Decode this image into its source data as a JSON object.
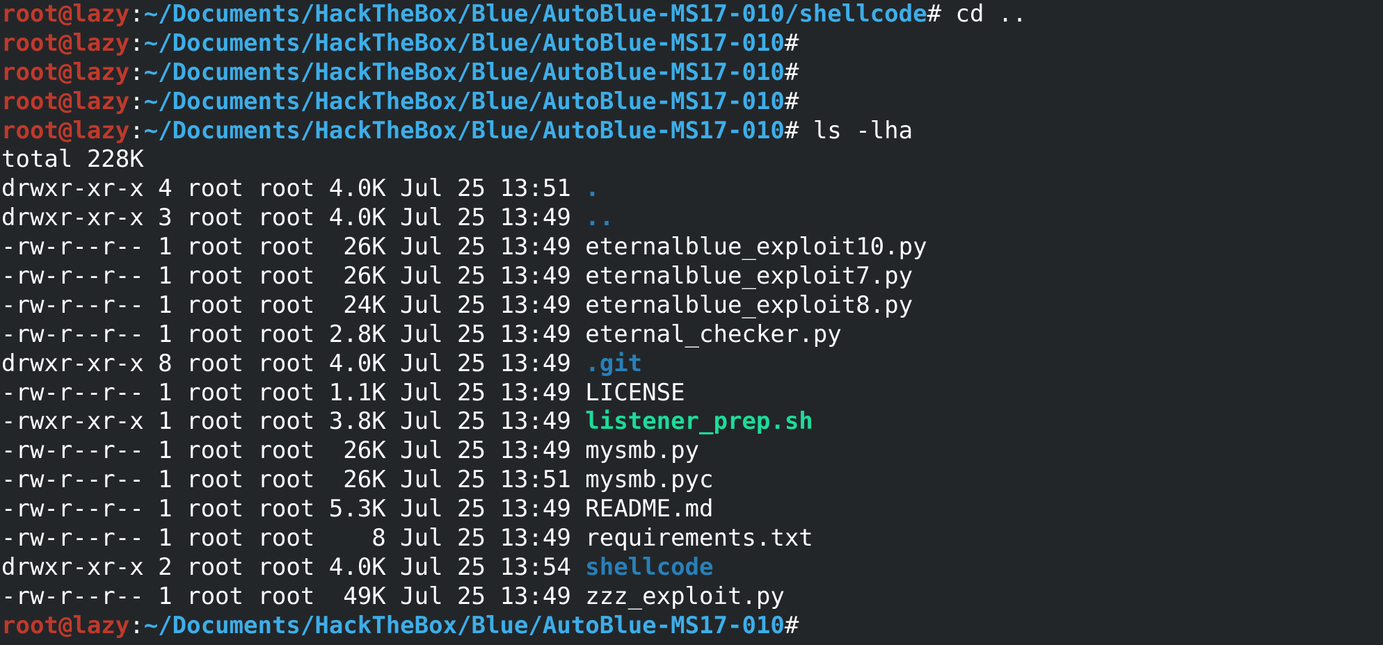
{
  "colors": {
    "background": "#232629",
    "foreground": "#fcfcfc",
    "prompt_user": "#c0392b",
    "prompt_path": "#3daee9",
    "directory": "#2980b9",
    "executable": "#1cdc9a"
  },
  "lines": [
    {
      "type": "prompt",
      "user_host": "root@lazy",
      "sep": ":",
      "path": "~/Documents/HackTheBox/Blue/AutoBlue-MS17-010/shellcode",
      "symbol": "#",
      "command": " cd .."
    },
    {
      "type": "prompt",
      "user_host": "root@lazy",
      "sep": ":",
      "path": "~/Documents/HackTheBox/Blue/AutoBlue-MS17-010",
      "symbol": "#",
      "command": ""
    },
    {
      "type": "prompt",
      "user_host": "root@lazy",
      "sep": ":",
      "path": "~/Documents/HackTheBox/Blue/AutoBlue-MS17-010",
      "symbol": "#",
      "command": ""
    },
    {
      "type": "prompt",
      "user_host": "root@lazy",
      "sep": ":",
      "path": "~/Documents/HackTheBox/Blue/AutoBlue-MS17-010",
      "symbol": "#",
      "command": ""
    },
    {
      "type": "prompt",
      "user_host": "root@lazy",
      "sep": ":",
      "path": "~/Documents/HackTheBox/Blue/AutoBlue-MS17-010",
      "symbol": "#",
      "command": " ls -lha"
    },
    {
      "type": "text",
      "text": "total 228K"
    },
    {
      "type": "entry",
      "meta": "drwxr-xr-x 4 root root 4.0K Jul 25 13:51 ",
      "name": ".",
      "kind": "dir"
    },
    {
      "type": "entry",
      "meta": "drwxr-xr-x 3 root root 4.0K Jul 25 13:49 ",
      "name": "..",
      "kind": "dir"
    },
    {
      "type": "entry",
      "meta": "-rw-r--r-- 1 root root  26K Jul 25 13:49 ",
      "name": "eternalblue_exploit10.py",
      "kind": "file"
    },
    {
      "type": "entry",
      "meta": "-rw-r--r-- 1 root root  26K Jul 25 13:49 ",
      "name": "eternalblue_exploit7.py",
      "kind": "file"
    },
    {
      "type": "entry",
      "meta": "-rw-r--r-- 1 root root  24K Jul 25 13:49 ",
      "name": "eternalblue_exploit8.py",
      "kind": "file"
    },
    {
      "type": "entry",
      "meta": "-rw-r--r-- 1 root root 2.8K Jul 25 13:49 ",
      "name": "eternal_checker.py",
      "kind": "file"
    },
    {
      "type": "entry",
      "meta": "drwxr-xr-x 8 root root 4.0K Jul 25 13:49 ",
      "name": ".git",
      "kind": "dir"
    },
    {
      "type": "entry",
      "meta": "-rw-r--r-- 1 root root 1.1K Jul 25 13:49 ",
      "name": "LICENSE",
      "kind": "file"
    },
    {
      "type": "entry",
      "meta": "-rwxr-xr-x 1 root root 3.8K Jul 25 13:49 ",
      "name": "listener_prep.sh",
      "kind": "exec"
    },
    {
      "type": "entry",
      "meta": "-rw-r--r-- 1 root root  26K Jul 25 13:49 ",
      "name": "mysmb.py",
      "kind": "file"
    },
    {
      "type": "entry",
      "meta": "-rw-r--r-- 1 root root  26K Jul 25 13:51 ",
      "name": "mysmb.pyc",
      "kind": "file"
    },
    {
      "type": "entry",
      "meta": "-rw-r--r-- 1 root root 5.3K Jul 25 13:49 ",
      "name": "README.md",
      "kind": "file"
    },
    {
      "type": "entry",
      "meta": "-rw-r--r-- 1 root root    8 Jul 25 13:49 ",
      "name": "requirements.txt",
      "kind": "file"
    },
    {
      "type": "entry",
      "meta": "drwxr-xr-x 2 root root 4.0K Jul 25 13:54 ",
      "name": "shellcode",
      "kind": "dir"
    },
    {
      "type": "entry",
      "meta": "-rw-r--r-- 1 root root  49K Jul 25 13:49 ",
      "name": "zzz_exploit.py",
      "kind": "file"
    },
    {
      "type": "prompt",
      "user_host": "root@lazy",
      "sep": ":",
      "path": "~/Documents/HackTheBox/Blue/AutoBlue-MS17-010",
      "symbol": "#",
      "command": ""
    }
  ]
}
